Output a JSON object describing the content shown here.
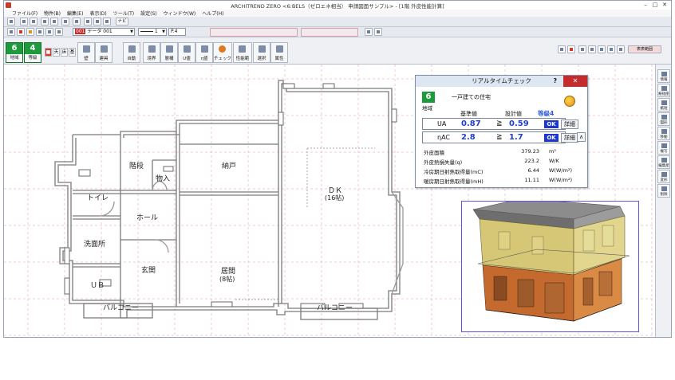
{
  "window": {
    "title": "ARCHITREND ZERO <6:BELS（ゼロエネ相当） 申請図面サンプル> - [1階 外皮性能計算]"
  },
  "menu": [
    "ファイル(F)",
    "物件(B)",
    "編集(E)",
    "表示(D)",
    "ツール(T)",
    "設定(S)",
    "ウィンドウ(W)",
    "ヘルプ(H)"
  ],
  "toolbar": {
    "tab_nav": "ナビ",
    "layer_code": "001",
    "layer_name": "データ 001",
    "line_width": "1",
    "pen": "P.4"
  },
  "command_bar": {
    "region_num": "6",
    "region_label": "地域",
    "grade_num": "4",
    "grade_label": "等級",
    "keys": [
      "天",
      "床",
      "基"
    ],
    "buttons": [
      "壁",
      "建具",
      "自動",
      "境界",
      "層構",
      "U値",
      "η値",
      "チェック",
      "性能範",
      "選択",
      "属性"
    ],
    "view_range": "表表範囲"
  },
  "palette": [
    "情報",
    "紙短座",
    "紙短",
    "図形",
    "移動",
    "複写",
    "編集屋",
    "変形",
    "削除"
  ],
  "rooms": {
    "stairs": "階段",
    "storage_in": "物入",
    "closet": "納戸",
    "toilet": "トイレ",
    "hall": "ホール",
    "washroom": "洗面所",
    "entrance": "玄関",
    "living": "居間",
    "living_size": "(8帖)",
    "dk": "ＤＫ",
    "dk_size": "(16帖)",
    "ub": "ＵＢ",
    "balcony1": "バルコニー",
    "balcony2": "バルコニー"
  },
  "check_panel": {
    "title": "リアルタイムチェック",
    "help": "?",
    "close": "✕",
    "region_num": "6",
    "region_label": "地域",
    "house_type": "一戸建ての住宅",
    "col_standard": "基準値",
    "col_design": "設計値",
    "grade": "等級4",
    "rows": [
      {
        "name": "UA",
        "standard": "0.87",
        "cmp": "≧",
        "design": "0.59",
        "status": "OK",
        "detail": "詳細"
      },
      {
        "name": "ηAC",
        "standard": "2.8",
        "cmp": "≧",
        "design": "1.7",
        "status": "OK",
        "detail": "詳細"
      }
    ],
    "collapse": "∧",
    "metrics": [
      {
        "label": "外皮面積",
        "value": "379.23",
        "unit": "m²"
      },
      {
        "label": "外皮熱損失量(q)",
        "value": "223.2",
        "unit": "W/K"
      },
      {
        "label": "冷房期日射熱取得量(mC)",
        "value": "6.44",
        "unit": "W(W/m²)"
      },
      {
        "label": "暖房期日射熱取得量(mH)",
        "value": "11.11",
        "unit": "W(W/m²)"
      }
    ]
  },
  "colors": {
    "accent_green": "#1c9a3c",
    "ok_blue": "#1c37c9",
    "value_blue": "#1f3fd0",
    "close_red": "#c62b2b",
    "grid": "#d99aa6"
  }
}
